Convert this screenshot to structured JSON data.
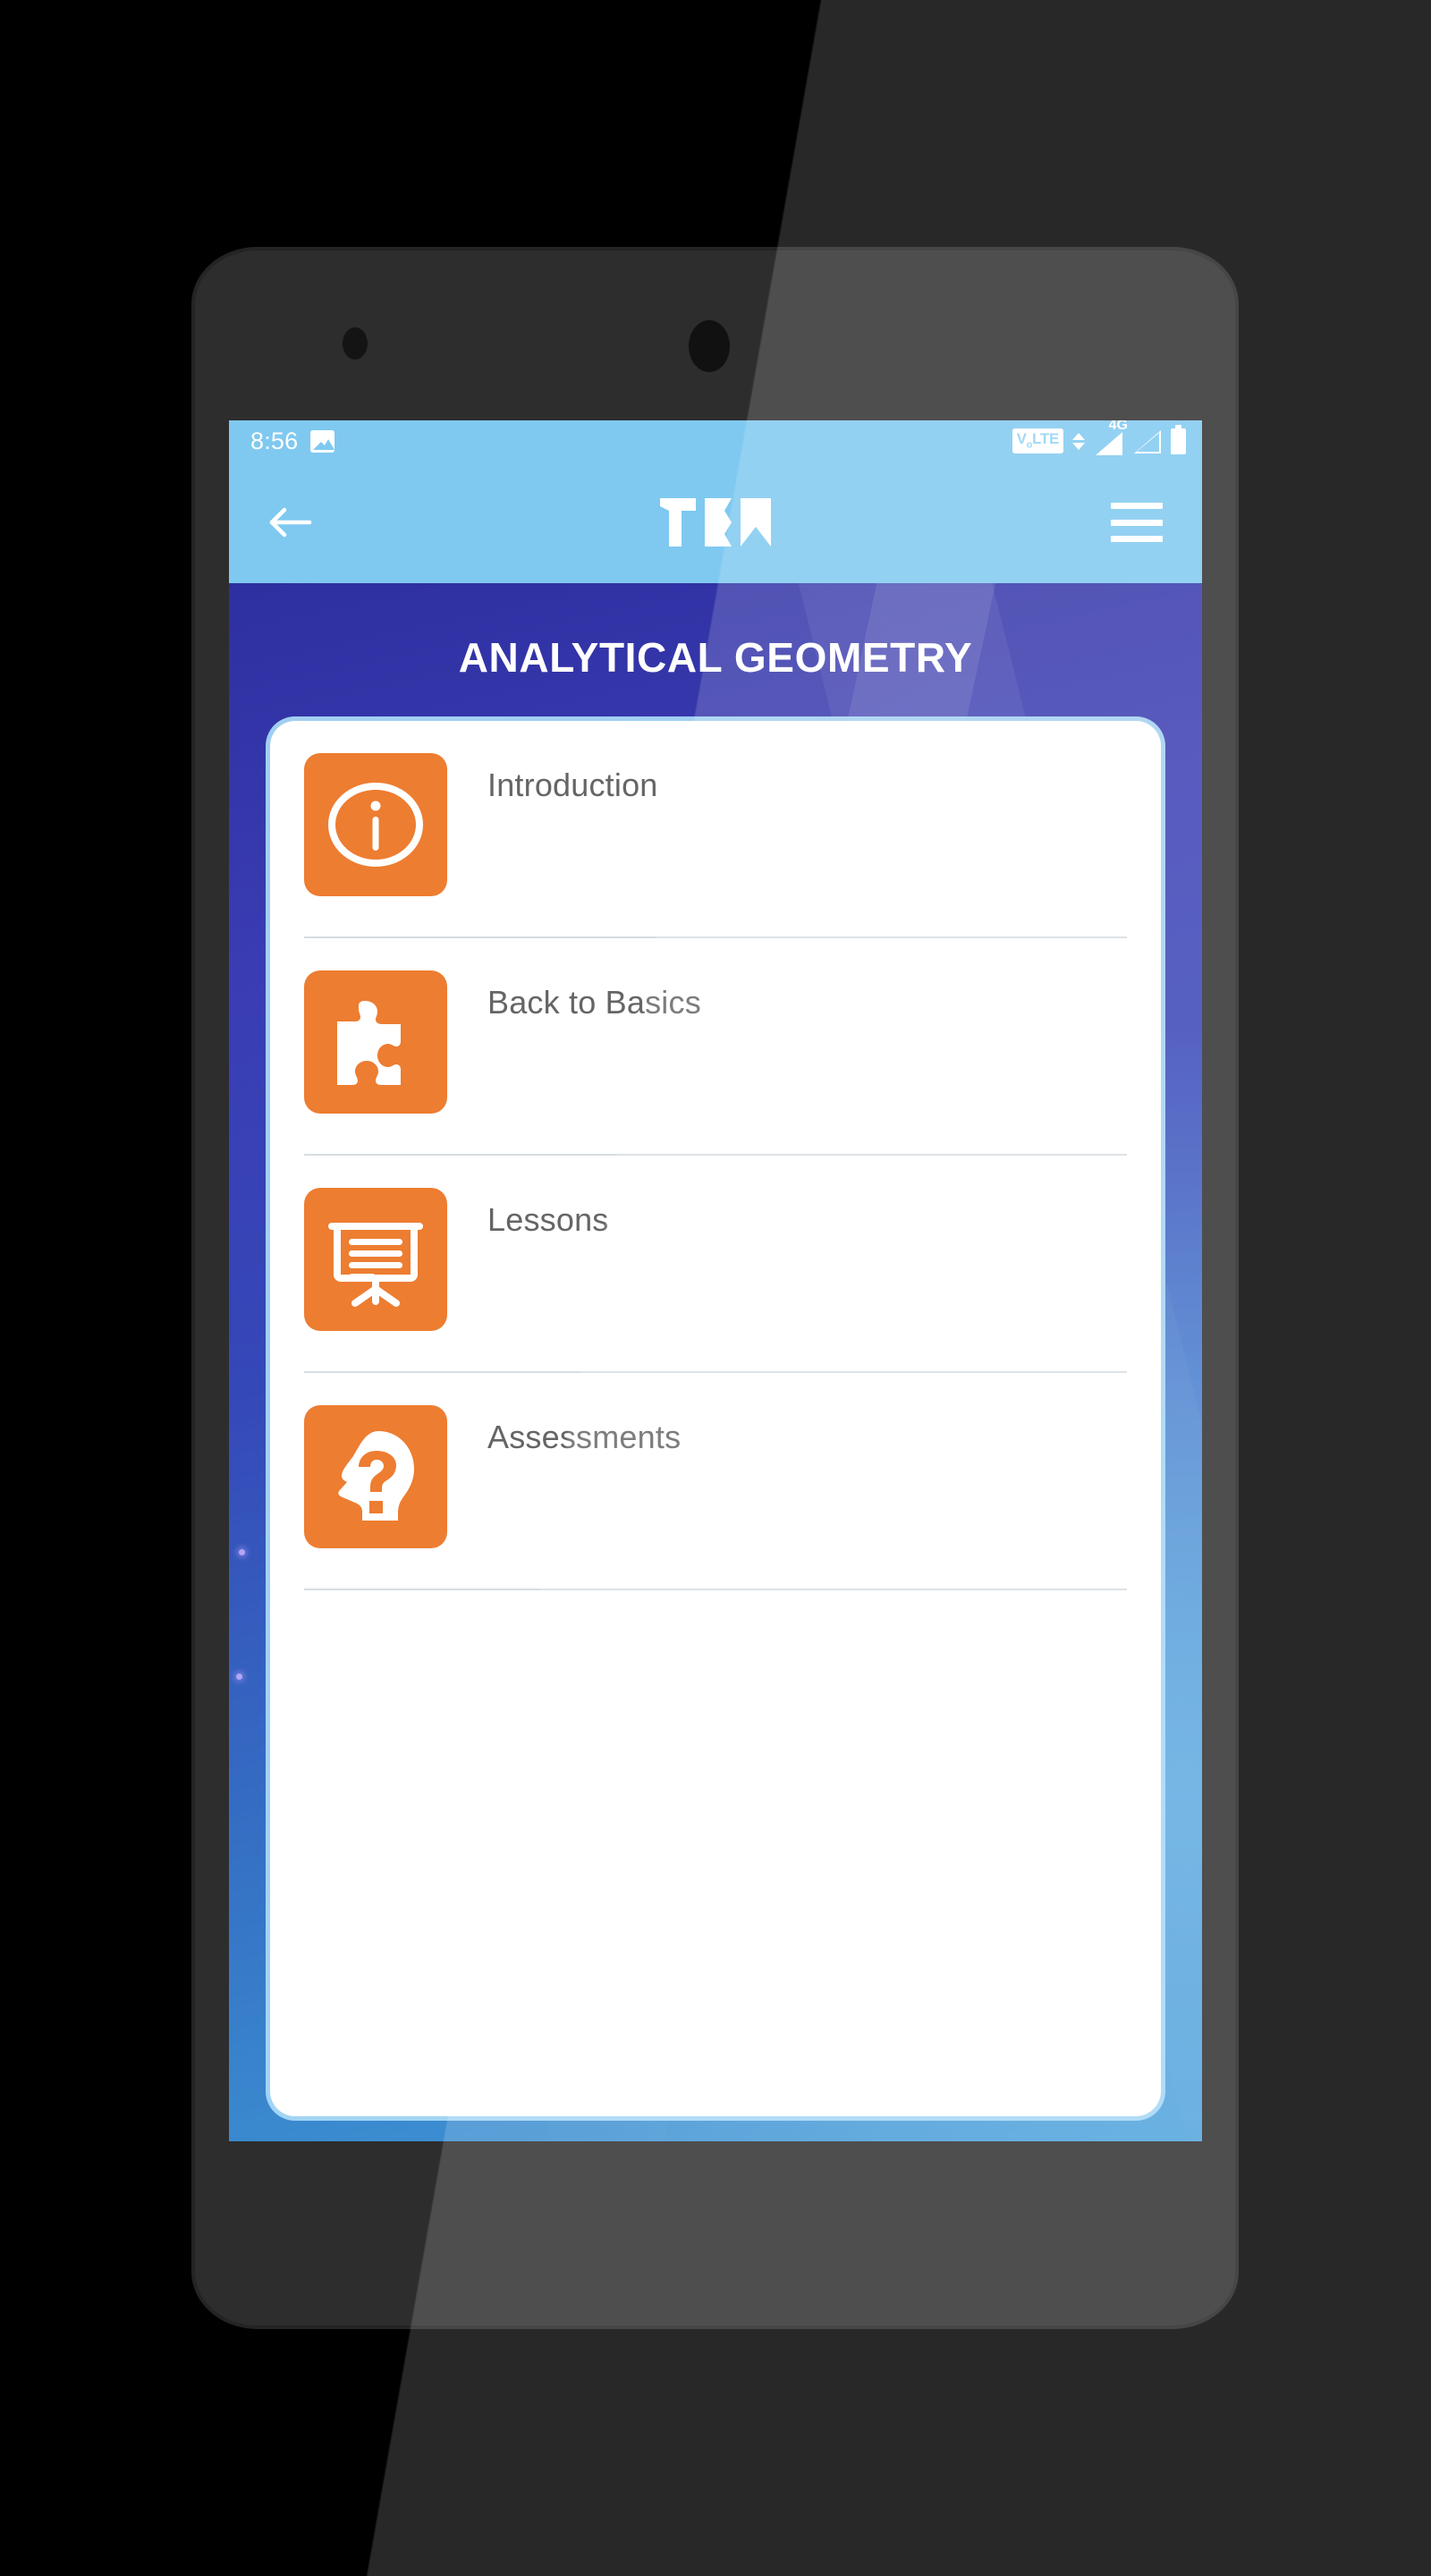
{
  "device": {
    "frame_color": "#2d2d2d",
    "screen_bg": "#1f2bad"
  },
  "status_bar": {
    "clock": "8:56",
    "left_icons": [
      {
        "name": "image-icon",
        "glyph": "picture"
      }
    ],
    "right_icons": [
      {
        "name": "volte-badge",
        "label": "VoLTE"
      },
      {
        "name": "data-transfer-icon",
        "glyph": "up-down-arrows"
      },
      {
        "name": "network-type-label",
        "label": "4G"
      },
      {
        "name": "signal-strength-icon-sim1",
        "glyph": "signal-triangle-filled"
      },
      {
        "name": "signal-strength-icon-sim2",
        "glyph": "signal-triangle-outline"
      },
      {
        "name": "battery-icon",
        "glyph": "battery"
      }
    ],
    "bg_color": "#7FC9F0"
  },
  "toolbar": {
    "back_label": "Back",
    "logo_alt": "App logo",
    "menu_label": "Menu",
    "bg_color": "#7FC9F0"
  },
  "header": {
    "title": "ANALYTICAL GEOMETRY"
  },
  "menu": {
    "accent_color": "#ED7D31",
    "card_bg": "#ffffff",
    "label_color": "#656565",
    "items": [
      {
        "label": "Introduction",
        "icon": "info-circle-icon"
      },
      {
        "label": "Back to Basics",
        "icon": "puzzle-piece-icon"
      },
      {
        "label": "Lessons",
        "icon": "presentation-board-icon"
      },
      {
        "label": "Assessments",
        "icon": "head-question-mark-icon"
      }
    ]
  }
}
